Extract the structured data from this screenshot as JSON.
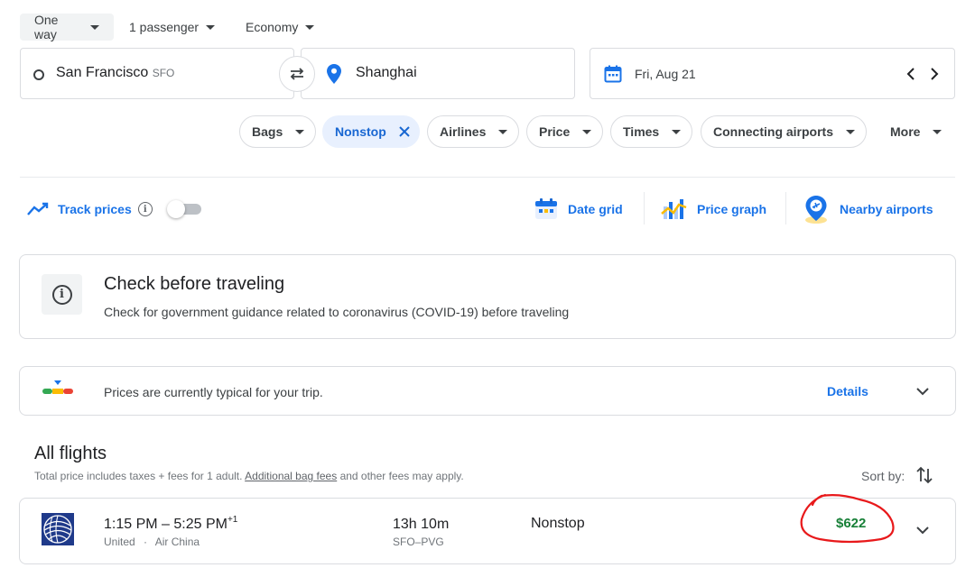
{
  "trip": {
    "type": "One way",
    "passengers": "1 passenger",
    "cabin": "Economy"
  },
  "search": {
    "origin_city": "San Francisco",
    "origin_code": "SFO",
    "destination": "Shanghai",
    "date": "Fri, Aug 21"
  },
  "filters": {
    "bags": "Bags",
    "nonstop": "Nonstop",
    "airlines": "Airlines",
    "price": "Price",
    "times": "Times",
    "connecting": "Connecting airports",
    "more": "More"
  },
  "tools": {
    "track_prices": "Track prices",
    "date_grid": "Date grid",
    "price_graph": "Price graph",
    "nearby_airports": "Nearby airports"
  },
  "notice": {
    "title": "Check before traveling",
    "body": "Check for government guidance related to coronavirus (COVID-19) before traveling"
  },
  "insight": {
    "text": "Prices are currently typical for your trip.",
    "details": "Details"
  },
  "results": {
    "heading": "All flights",
    "subtitle_pre": "Total price includes taxes + fees for 1 adult.",
    "bag_fees_link": "Additional bag fees",
    "subtitle_post": "and other fees may apply.",
    "sort_label": "Sort by:"
  },
  "flights": [
    {
      "times": "1:15 PM – 5:25 PM",
      "day_offset": "+1",
      "airline": "United",
      "operator": "Air China",
      "duration": "13h 10m",
      "route": "SFO–PVG",
      "stops": "Nonstop",
      "price": "$622"
    }
  ],
  "colors": {
    "accent": "#1a73e8",
    "price_green": "#188038",
    "annotation_red": "#e8191b",
    "united_blue": "#1f3a8a"
  }
}
